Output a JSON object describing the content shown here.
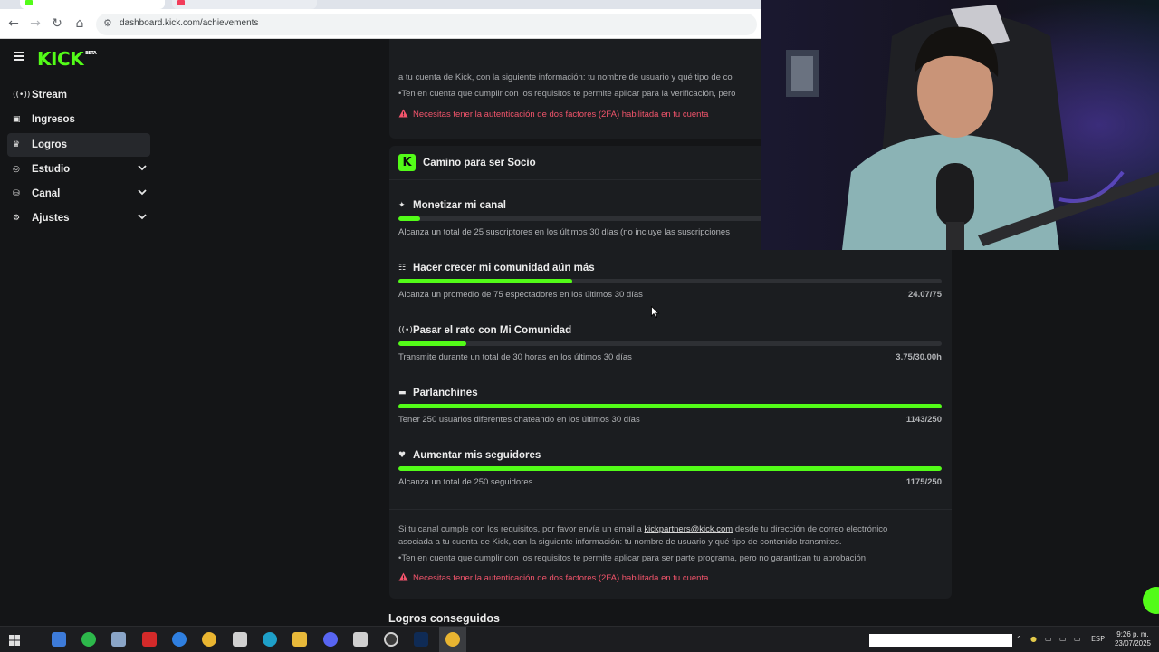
{
  "browser": {
    "url": "dashboard.kick.com/achievements"
  },
  "sidebar": {
    "logo": "KICK",
    "logo_badge": "BETA",
    "items": [
      {
        "label": "Stream",
        "icon": "broadcast-icon"
      },
      {
        "label": "Ingresos",
        "icon": "wallet-icon"
      },
      {
        "label": "Logros",
        "icon": "trophy-icon",
        "active": true
      },
      {
        "label": "Estudio",
        "icon": "studio-icon",
        "expandable": true
      },
      {
        "label": "Canal",
        "icon": "channel-icon",
        "expandable": true
      },
      {
        "label": "Ajustes",
        "icon": "gear-icon",
        "expandable": true
      }
    ]
  },
  "top_card": {
    "line_partial": "a tu cuenta de Kick, con la siguiente información: tu nombre de usuario y qué tipo de co",
    "note": "•Ten en cuenta que cumplir con los requisitos te permite aplicar para la verificación, pero",
    "warning": "Necesitas tener la autenticación de dos factores (2FA) habilitada en tu cuenta"
  },
  "partner_card": {
    "title": "Camino para ser Socio",
    "achievements": [
      {
        "name": "Monetizar mi canal",
        "icon": "sparkle-icon",
        "desc": "Alcanza un total de 25 suscriptores en los últimos 30 días (no incluye las suscripciones",
        "value": "",
        "progress": 0.04
      },
      {
        "name": "Hacer crecer mi comunidad aún más",
        "icon": "users-icon",
        "desc": "Alcanza un promedio de 75 espectadores en los últimos 30 días",
        "value": "24.07/75",
        "progress": 0.32
      },
      {
        "name": "Pasar el rato con Mi Comunidad",
        "icon": "broadcast-icon",
        "desc": "Transmite durante un total de 30 horas en los últimos 30 días",
        "value": "3.75/30.00h",
        "progress": 0.125
      },
      {
        "name": "Parlanchines",
        "icon": "chat-icon",
        "desc": "Tener 250 usuarios diferentes chateando en los últimos 30 días",
        "value": "1143/250",
        "progress": 1.0
      },
      {
        "name": "Aumentar mis seguidores",
        "icon": "heart-icon",
        "desc": "Alcanza un total de 250 seguidores",
        "value": "1175/250",
        "progress": 1.0
      }
    ],
    "info_pre": "Si tu canal cumple con los requisitos, por favor envía un email a ",
    "info_email": "kickpartners@kick.com",
    "info_post": " desde tu dirección de correo electrónico",
    "info_line2": "asociada a tu cuenta de Kick, con la siguiente información: tu nombre de usuario y qué tipo de contenido transmites.",
    "note": "•Ten en cuenta que cumplir con los requisitos te permite aplicar para ser parte programa, pero no garantizan tu aprobación.",
    "warning": "Necesitas tener la autenticación de dos factores (2FA) habilitada en tu cuenta"
  },
  "section_title": "Logros conseguidos",
  "taskbar": {
    "lang": "ESP",
    "time": "9:26 p. m.",
    "date": "23/07/2025"
  },
  "colors": {
    "kick_green": "#53fc18",
    "warning_red": "#f2546b",
    "background": "#141517",
    "card": "#1b1d20"
  }
}
